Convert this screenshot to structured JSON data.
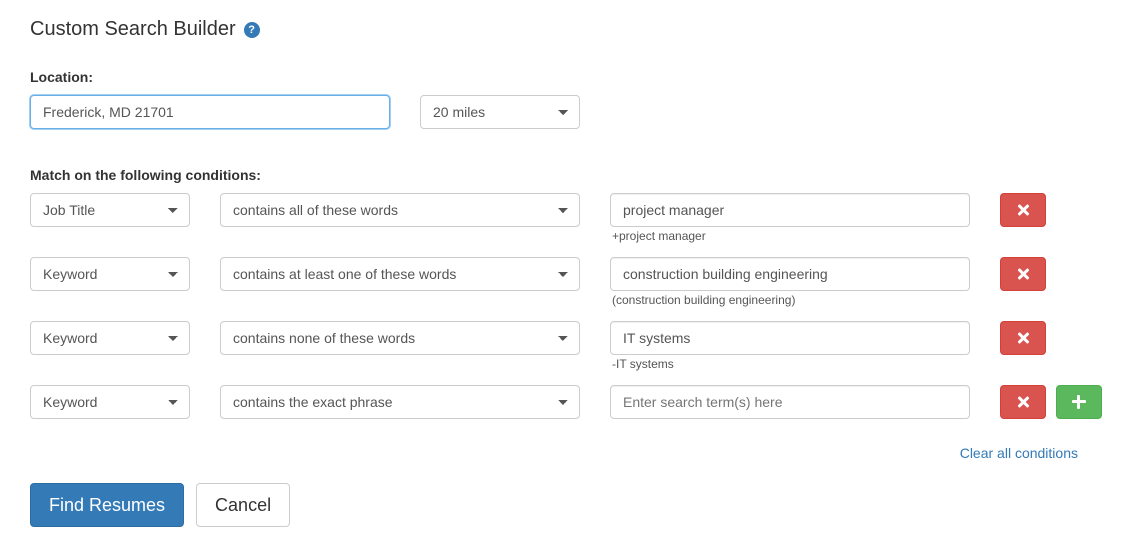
{
  "header": {
    "title": "Custom Search Builder"
  },
  "location": {
    "label": "Location:",
    "value": "Frederick, MD 21701",
    "radius_selected": "20 miles"
  },
  "conditions_label": "Match on the following conditions:",
  "conditions": [
    {
      "field": "Job Title",
      "operator": "contains all of these words",
      "term": "project manager",
      "hint": "+project manager"
    },
    {
      "field": "Keyword",
      "operator": "contains at least one of these words",
      "term": "construction building engineering",
      "hint": "(construction building engineering)"
    },
    {
      "field": "Keyword",
      "operator": "contains none of these words",
      "term": "IT systems",
      "hint": "-IT systems"
    },
    {
      "field": "Keyword",
      "operator": "contains the exact phrase",
      "term": "",
      "placeholder": "Enter search term(s) here",
      "hint": ""
    }
  ],
  "links": {
    "clear_all": "Clear all conditions"
  },
  "buttons": {
    "submit": "Find Resumes",
    "cancel": "Cancel"
  }
}
